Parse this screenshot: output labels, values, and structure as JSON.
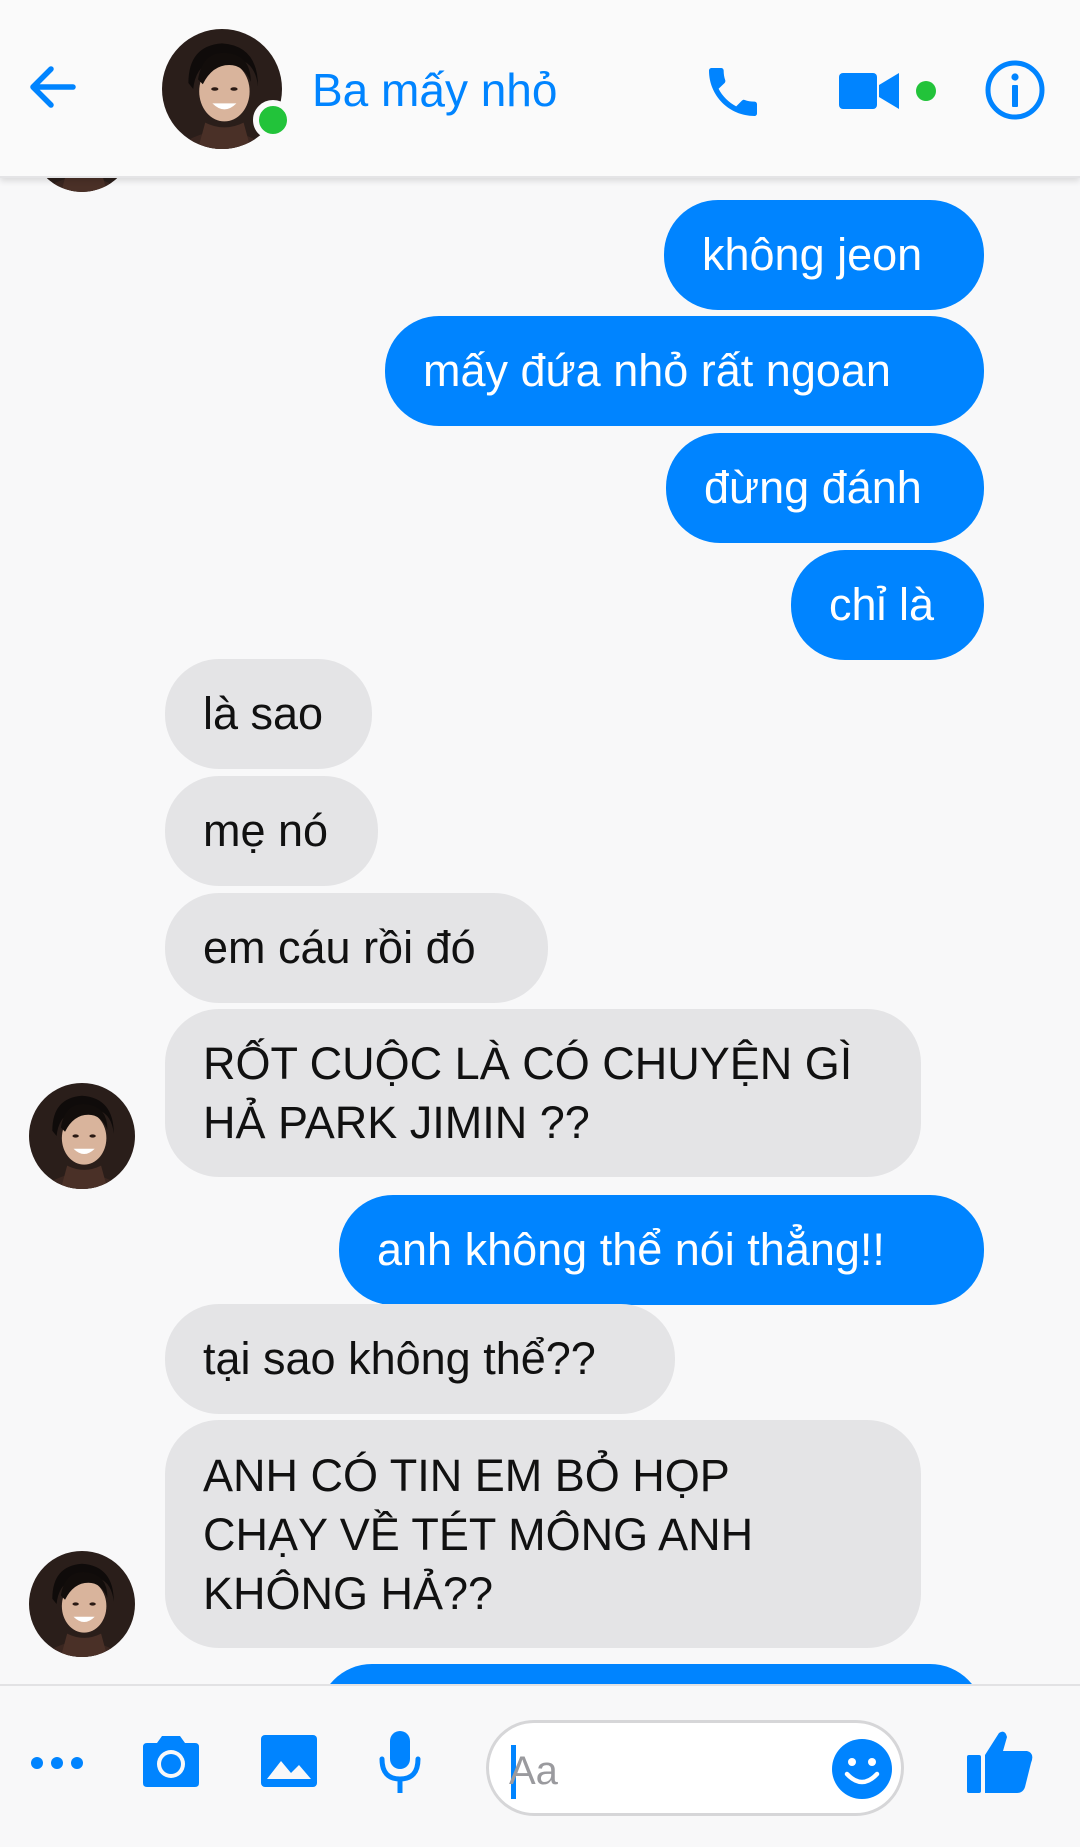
{
  "header": {
    "title": "Ba mấy nhỏ",
    "back_icon": "arrow-left-icon",
    "call_icon": "phone-icon",
    "video_icon": "video-camera-icon",
    "info_icon": "info-icon",
    "online": true,
    "accent_color": "#0084ff",
    "online_color": "#22c33a"
  },
  "messages": [
    {
      "side": "out",
      "text": "không jeon"
    },
    {
      "side": "out",
      "text": "mấy đứa nhỏ rất ngoan"
    },
    {
      "side": "out",
      "text": "đừng đánh"
    },
    {
      "side": "out",
      "text": "chỉ là"
    },
    {
      "side": "in",
      "text": "là sao"
    },
    {
      "side": "in",
      "text": "mẹ nó"
    },
    {
      "side": "in",
      "text": "em cáu rồi đó"
    },
    {
      "side": "in",
      "text": "RỐT CUỘC LÀ CÓ CHUYỆN GÌ HẢ PARK JIMIN ??"
    },
    {
      "side": "out",
      "text": "anh không thể nói thẳng!!"
    },
    {
      "side": "in",
      "text": "tại sao không thể??"
    },
    {
      "side": "in",
      "text": "ANH CÓ TIN EM BỎ HỌP CHẠY VỀ TÉT MÔNG ANH KHÔNG HẢ??"
    },
    {
      "side": "out",
      "text": ""
    }
  ],
  "composer": {
    "placeholder": "Aa",
    "value": "",
    "more_icon": "more-dots-icon",
    "camera_icon": "camera-icon",
    "gallery_icon": "image-icon",
    "mic_icon": "microphone-icon",
    "emoji_icon": "smiley-icon",
    "like_icon": "thumbs-up-icon"
  },
  "colors": {
    "outgoing_bubble": "#0084ff",
    "incoming_bubble": "#e4e4e6",
    "background": "#f8f8f9"
  }
}
